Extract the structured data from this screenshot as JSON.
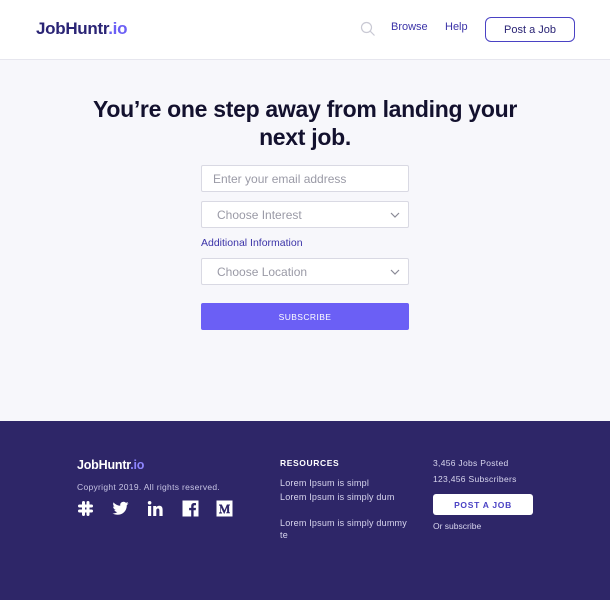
{
  "header": {
    "logo_main": "JobHuntr",
    "logo_suffix": ".io",
    "nav": {
      "browse": "Browse",
      "help": "Help"
    },
    "post_job": "Post a Job"
  },
  "hero": {
    "title_line1": "You’re one step away from landing your",
    "title_line2": "next job."
  },
  "form": {
    "email_placeholder": "Enter your email address",
    "interest_value": "Choose Interest",
    "additional_label": "Additional Information",
    "location_value": "Choose Location",
    "subscribe": "SUBSCRIBE"
  },
  "footer": {
    "logo_main": "JobHuntr",
    "logo_suffix": ".io",
    "copyright": "Copyright 2019. All rights reserved.",
    "social_icons": [
      "slack-icon",
      "twitter-icon",
      "linkedin-icon",
      "facebook-icon",
      "medium-icon"
    ],
    "resources": {
      "title": "RESOURCES",
      "links": [
        "Lorem Ipsum is simpl",
        "Lorem Ipsum is simply dum",
        "Lorem Ipsum is simply dummy te"
      ]
    },
    "stats": {
      "jobs": "3,456 Jobs Posted",
      "subscribers": "123,456 Subscribers"
    },
    "post_job": "POST A JOB",
    "or_subscribe": "Or subscribe"
  },
  "colors": {
    "accent": "#6b5ff5",
    "brand_dark": "#2a2475",
    "footer_bg": "#2e2668",
    "page_bg": "#f7f7fb"
  }
}
